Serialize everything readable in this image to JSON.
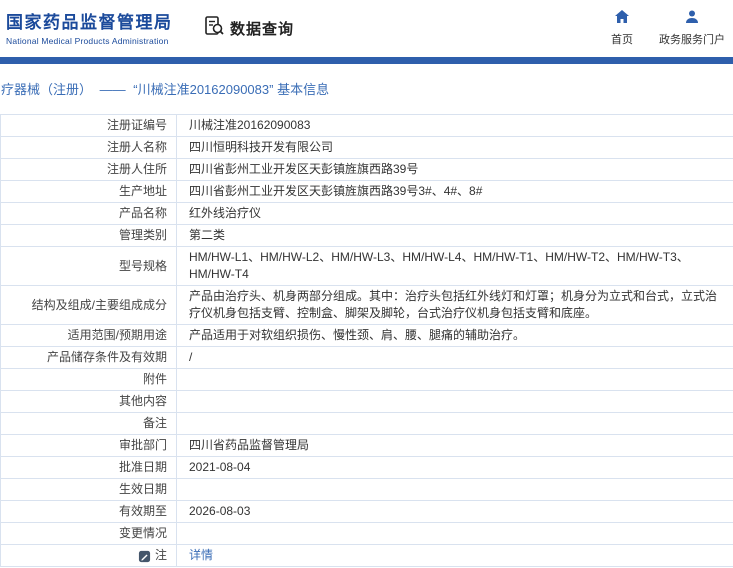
{
  "header": {
    "site_title": "国家药品监督管理局",
    "site_subtitle": "National Medical Products Administration",
    "section_title": "数据查询",
    "nav_home": "首页",
    "nav_portal": "政务服务门户"
  },
  "colors": {
    "brand_blue": "#1b4a9b",
    "bar_blue": "#2e5fac",
    "link_blue": "#3a6db6",
    "table_border": "#d9e2ef"
  },
  "breadcrumb": {
    "category": "疗器械（注册）",
    "separator": "——",
    "title": "“川械注准20162090083” 基本信息"
  },
  "table": {
    "rows": [
      {
        "label": "注册证编号",
        "value": "川械注准20162090083"
      },
      {
        "label": "注册人名称",
        "value": "四川恒明科技开发有限公司"
      },
      {
        "label": "注册人住所",
        "value": "四川省彭州工业开发区天彭镇旌旗西路39号"
      },
      {
        "label": "生产地址",
        "value": "四川省彭州工业开发区天彭镇旌旗西路39号3#、4#、8#"
      },
      {
        "label": "产品名称",
        "value": "红外线治疗仪"
      },
      {
        "label": "管理类别",
        "value": "第二类"
      },
      {
        "label": "型号规格",
        "value": "HM/HW-L1、HM/HW-L2、HM/HW-L3、HM/HW-L4、HM/HW-T1、HM/HW-T2、HM/HW-T3、HM/HW-T4"
      },
      {
        "label": "结构及组成/主要组成成分",
        "value": "产品由治疗头、机身两部分组成。其中：治疗头包括红外线灯和灯罩；机身分为立式和台式，立式治疗仪机身包括支臂、控制盒、脚架及脚轮，台式治疗仪机身包括支臂和底座。"
      },
      {
        "label": "适用范围/预期用途",
        "value": "产品适用于对软组织损伤、慢性颈、肩、腰、腿痛的辅助治疗。"
      },
      {
        "label": "产品储存条件及有效期",
        "value": "/"
      },
      {
        "label": "附件",
        "value": ""
      },
      {
        "label": "其他内容",
        "value": ""
      },
      {
        "label": "备注",
        "value": ""
      },
      {
        "label": "审批部门",
        "value": "四川省药品监督管理局"
      },
      {
        "label": "批准日期",
        "value": "2021-08-04"
      },
      {
        "label": "生效日期",
        "value": ""
      },
      {
        "label": "有效期至",
        "value": "2026-08-03"
      },
      {
        "label": "变更情况",
        "value": ""
      },
      {
        "label": "注",
        "value": "详情"
      }
    ]
  }
}
